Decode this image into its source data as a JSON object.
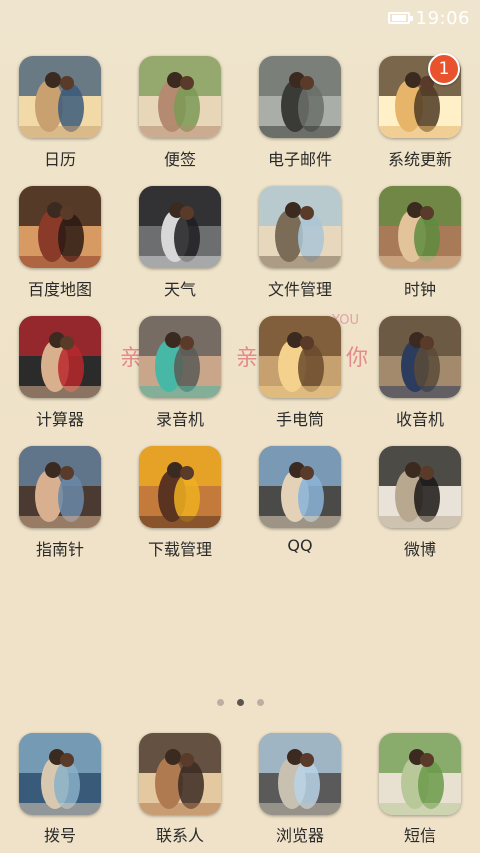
{
  "status_bar": {
    "time": "19:06"
  },
  "apps": [
    {
      "label": "日历",
      "icon": "calendar-photo-icon",
      "palette": [
        "#3b5a7a",
        "#c9a070",
        "#f1d9a8"
      ]
    },
    {
      "label": "便签",
      "icon": "memo-photo-icon",
      "palette": [
        "#7a9a55",
        "#b48a70",
        "#e8d6b8"
      ]
    },
    {
      "label": "电子邮件",
      "icon": "email-photo-icon",
      "palette": [
        "#6b6f6a",
        "#3a3a36",
        "#a9aea8"
      ]
    },
    {
      "label": "系统更新",
      "icon": "system-update-photo-icon",
      "palette": [
        "#4d3a22",
        "#e6b56a",
        "#fff0c8"
      ],
      "badge": "1"
    },
    {
      "label": "百度地图",
      "icon": "baidu-map-photo-icon",
      "palette": [
        "#2a1a14",
        "#8a3a28",
        "#d79a62"
      ]
    },
    {
      "label": "天气",
      "icon": "weather-photo-icon",
      "palette": [
        "#1f1f22",
        "#d8d8d8",
        "#6c6e70"
      ]
    },
    {
      "label": "文件管理",
      "icon": "file-manager-photo-icon",
      "palette": [
        "#a9c6d6",
        "#7b6c58",
        "#e7d8bd"
      ]
    },
    {
      "label": "时钟",
      "icon": "clock-photo-icon",
      "palette": [
        "#5e8c3f",
        "#e2c39a",
        "#a97a58"
      ]
    },
    {
      "label": "计算器",
      "icon": "calculator-photo-icon",
      "palette": [
        "#b8282d",
        "#d9b08e",
        "#2b2b2b"
      ]
    },
    {
      "label": "录音机",
      "icon": "recorder-photo-icon",
      "palette": [
        "#5b5a55",
        "#48b8a6",
        "#c9a58a"
      ]
    },
    {
      "label": "手电筒",
      "icon": "flashlight-photo-icon",
      "palette": [
        "#6a4a2c",
        "#f4d28e",
        "#c7a070"
      ]
    },
    {
      "label": "收音机",
      "icon": "radio-photo-icon",
      "palette": [
        "#5a4a38",
        "#2c3c5e",
        "#a48a6c"
      ]
    },
    {
      "label": "指南针",
      "icon": "compass-photo-icon",
      "palette": [
        "#6a8aa8",
        "#d8b090",
        "#4a3a32"
      ]
    },
    {
      "label": "下载管理",
      "icon": "download-manager-photo-icon",
      "palette": [
        "#f0b020",
        "#5a3420",
        "#c47a3a"
      ]
    },
    {
      "label": "QQ",
      "icon": "qq-photo-icon",
      "palette": [
        "#8ab4d8",
        "#e4d2b8",
        "#4a4a48"
      ]
    },
    {
      "label": "微博",
      "icon": "weibo-photo-icon",
      "palette": [
        "#1a1816",
        "#b8a890",
        "#e8e2d8"
      ]
    }
  ],
  "wallpaper_text": {
    "left": "亲",
    "right": "你",
    "small": "YOU",
    "mid": "亲"
  },
  "dock": [
    {
      "label": "拨号",
      "icon": "dialer-photo-icon",
      "palette": [
        "#8ab0c8",
        "#d8c8b0",
        "#3a5a7a"
      ]
    },
    {
      "label": "联系人",
      "icon": "contacts-photo-icon",
      "palette": [
        "#3a2a22",
        "#b07a50",
        "#e4c8a0"
      ]
    },
    {
      "label": "浏览器",
      "icon": "browser-photo-icon",
      "palette": [
        "#b8d4e8",
        "#c8c0b0",
        "#5a5a5a"
      ]
    },
    {
      "label": "短信",
      "icon": "messages-photo-icon",
      "palette": [
        "#6a9a4a",
        "#b8c898",
        "#e8e0d0"
      ]
    }
  ]
}
